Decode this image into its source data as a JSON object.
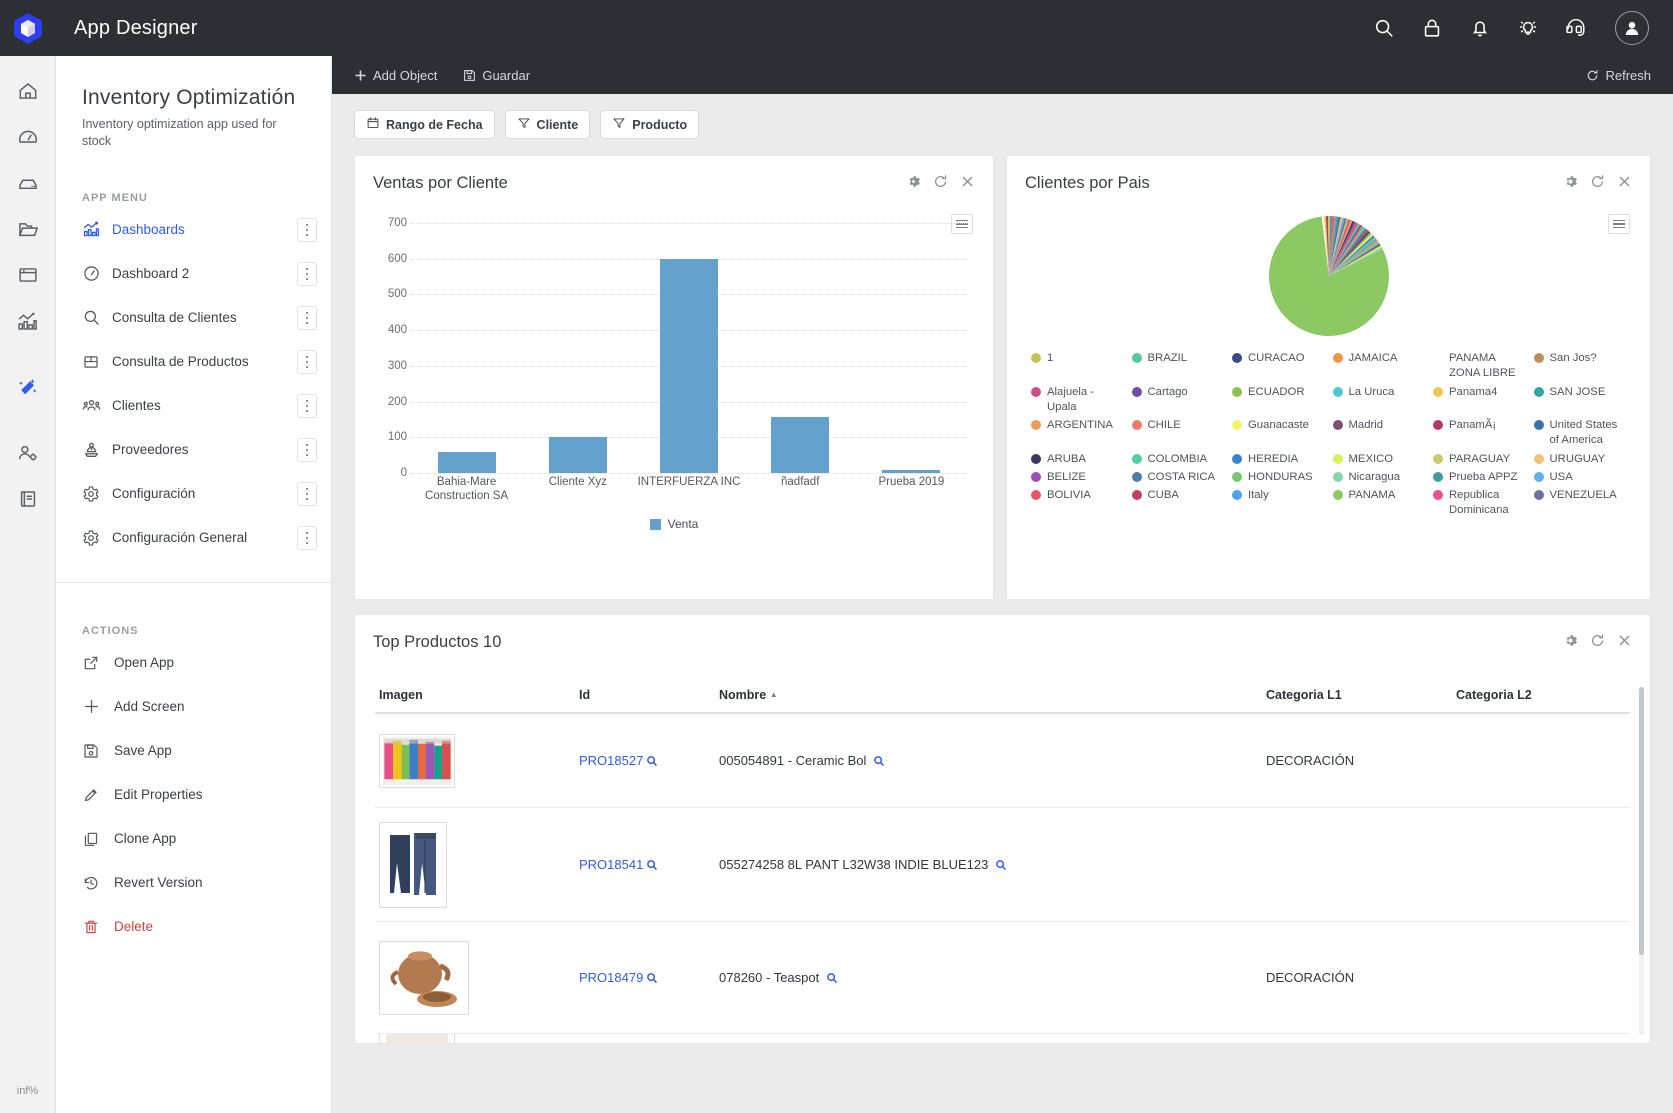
{
  "topbar": {
    "app_title": "App Designer",
    "icons": [
      "search-icon",
      "lock-icon",
      "bell-icon",
      "lightbulb-icon",
      "headset-icon",
      "avatar-icon"
    ]
  },
  "rail": {
    "items": [
      "home-icon",
      "gauge-icon",
      "server-icon",
      "folder-icon",
      "window-icon",
      "analytics-icon",
      "wand-icon",
      "user-settings-icon",
      "book-icon"
    ],
    "footer": "inf%"
  },
  "sidebar": {
    "title": "Inventory Optimizatión",
    "subtitle": "Inventory optimization app used for stock",
    "menu_label": "APP MENU",
    "menu": [
      {
        "label": "Dashboards",
        "icon": "analytics-icon",
        "active": true
      },
      {
        "label": "Dashboard 2",
        "icon": "gauge-icon",
        "active": false
      },
      {
        "label": "Consulta de Clientes",
        "icon": "search-icon",
        "active": false
      },
      {
        "label": "Consulta de Productos",
        "icon": "box-icon",
        "active": false
      },
      {
        "label": "Clientes",
        "icon": "people-icon",
        "active": false
      },
      {
        "label": "Proveedores",
        "icon": "supplier-icon",
        "active": false
      },
      {
        "label": "Configuración",
        "icon": "gear-icon",
        "active": false
      },
      {
        "label": "Configuración General",
        "icon": "gear-icon",
        "active": false
      }
    ],
    "actions_label": "ACTIONS",
    "actions": [
      {
        "label": "Open App",
        "icon": "external-link-icon",
        "danger": false
      },
      {
        "label": "Add Screen",
        "icon": "plus-icon",
        "danger": false
      },
      {
        "label": "Save App",
        "icon": "save-icon",
        "danger": false
      },
      {
        "label": "Edit Properties",
        "icon": "pencil-icon",
        "danger": false
      },
      {
        "label": "Clone App",
        "icon": "copy-icon",
        "danger": false
      },
      {
        "label": "Revert Version",
        "icon": "history-icon",
        "danger": false
      },
      {
        "label": "Delete",
        "icon": "trash-icon",
        "danger": true
      }
    ]
  },
  "objectbar": {
    "add_object": "Add Object",
    "guardar": "Guardar",
    "refresh": "Refresh"
  },
  "filters": [
    {
      "label": "Rango de Fecha",
      "icon": "calendar-icon"
    },
    {
      "label": "Cliente",
      "icon": "filter-icon"
    },
    {
      "label": "Producto",
      "icon": "filter-icon"
    }
  ],
  "cards": {
    "bar_title": "Ventas por Cliente",
    "pie_title": "Clientes por Pais",
    "table_title": "Top Productos 10"
  },
  "table": {
    "columns": [
      "Imagen",
      "Id",
      "Nombre",
      "Categoria L1",
      "Categoria L2"
    ],
    "sorted_column": "Nombre",
    "sort_direction": "asc",
    "rows": [
      {
        "id": "PRO18527",
        "nombre": "005054891 - Ceramic Bol",
        "l1": "DECORACIÓN",
        "l2": "",
        "thumb": "colorful-bottles"
      },
      {
        "id": "PRO18541",
        "nombre": "055274258 8L PANT L32W38 INDIE BLUE123",
        "l1": "",
        "l2": "",
        "thumb": "blue-jeans"
      },
      {
        "id": "PRO18479",
        "nombre": "078260 - Teaspot",
        "l1": "DECORACIÓN",
        "l2": "",
        "thumb": "clay-teapot"
      }
    ]
  },
  "chart_data": [
    {
      "type": "bar",
      "title": "Ventas por Cliente",
      "categories": [
        "Bahia-Mare Construction SA",
        "Cliente Xyz",
        "INTERFUERZA INC",
        "ñadfadf",
        "Prueba 2019"
      ],
      "values": [
        60,
        102,
        600,
        158,
        5
      ],
      "series": [
        {
          "name": "Venta",
          "values": [
            60,
            102,
            600,
            158,
            5
          ]
        }
      ],
      "yticks": [
        0,
        100,
        200,
        300,
        400,
        500,
        600,
        700
      ],
      "ylim": [
        0,
        700
      ],
      "xlabel": "",
      "ylabel": "",
      "legend": [
        "Venta"
      ],
      "legend_position": "bottom",
      "grid": true,
      "bar_color": "#64a2cd"
    },
    {
      "type": "pie",
      "title": "Clientes por Pais",
      "legend_position": "bottom",
      "slices": [
        {
          "label": "1",
          "color": "#c4c455",
          "value": 0.5
        },
        {
          "label": "Alajuela - Upala",
          "color": "#c9508a",
          "value": 0.5
        },
        {
          "label": "ARGENTINA",
          "color": "#ef9a5c",
          "value": 0.5
        },
        {
          "label": "ARUBA",
          "color": "#3c3a5e",
          "value": 0.5
        },
        {
          "label": "BELIZE",
          "color": "#9b50b5",
          "value": 0.5
        },
        {
          "label": "BOLIVIA",
          "color": "#ec5566",
          "value": 0.5
        },
        {
          "label": "BRAZIL",
          "color": "#56c8a0",
          "value": 0.5
        },
        {
          "label": "Cartago",
          "color": "#6b4fa3",
          "value": 0.5
        },
        {
          "label": "CHILE",
          "color": "#f07a6e",
          "value": 0.5
        },
        {
          "label": "COLOMBIA",
          "color": "#4ecfa5",
          "value": 0.5
        },
        {
          "label": "COSTA RICA",
          "color": "#4a7eb0",
          "value": 0.5
        },
        {
          "label": "CUBA",
          "color": "#c1415c",
          "value": 0.5
        },
        {
          "label": "CURACAO",
          "color": "#374a8c",
          "value": 0.5
        },
        {
          "label": "ECUADOR",
          "color": "#8cc152",
          "value": 0.5
        },
        {
          "label": "Guanacaste",
          "color": "#f5f264",
          "value": 0.5
        },
        {
          "label": "HEREDIA",
          "color": "#3b82d0",
          "value": 0.5
        },
        {
          "label": "HONDURAS",
          "color": "#7bc470",
          "value": 0.5
        },
        {
          "label": "Italy",
          "color": "#4aa3ec",
          "value": 0.5
        },
        {
          "label": "JAMAICA",
          "color": "#ef9640",
          "value": 0.5
        },
        {
          "label": "La Uruca",
          "color": "#4fc9cf",
          "value": 0.5
        },
        {
          "label": "Madrid",
          "color": "#7a4f78",
          "value": 0.5
        },
        {
          "label": "MEXICO",
          "color": "#d7f255",
          "value": 0.5
        },
        {
          "label": "Nicaragua",
          "color": "#86d6ab",
          "value": 0.5
        },
        {
          "label": "PANAMA",
          "color": "#8dc963",
          "value": 72.0
        },
        {
          "label": "PANAMA ZONA LIBRE",
          "color": "#ffffff",
          "value": 0.5
        },
        {
          "label": "Panama4",
          "color": "#f1c453",
          "value": 0.5
        },
        {
          "label": "PanamÃ¡",
          "color": "#b4396b",
          "value": 0.5
        },
        {
          "label": "PARAGUAY",
          "color": "#c9c96e",
          "value": 0.5
        },
        {
          "label": "Prueba APPZ",
          "color": "#3f9b9e",
          "value": 0.5
        },
        {
          "label": "Republica Dominicana",
          "color": "#ec4f92",
          "value": 0.5
        },
        {
          "label": "San Jos?",
          "color": "#bf8c5b",
          "value": 0.5
        },
        {
          "label": "SAN JOSE",
          "color": "#30a8a0",
          "value": 0.5
        },
        {
          "label": "United States of America",
          "color": "#3a72a8",
          "value": 0.5
        },
        {
          "label": "URUGUAY",
          "color": "#f2c179",
          "value": 0.5
        },
        {
          "label": "USA",
          "color": "#5bb1e8",
          "value": 0.5
        },
        {
          "label": "VENEZUELA",
          "color": "#6b6fa8",
          "value": 0.5
        }
      ]
    }
  ]
}
